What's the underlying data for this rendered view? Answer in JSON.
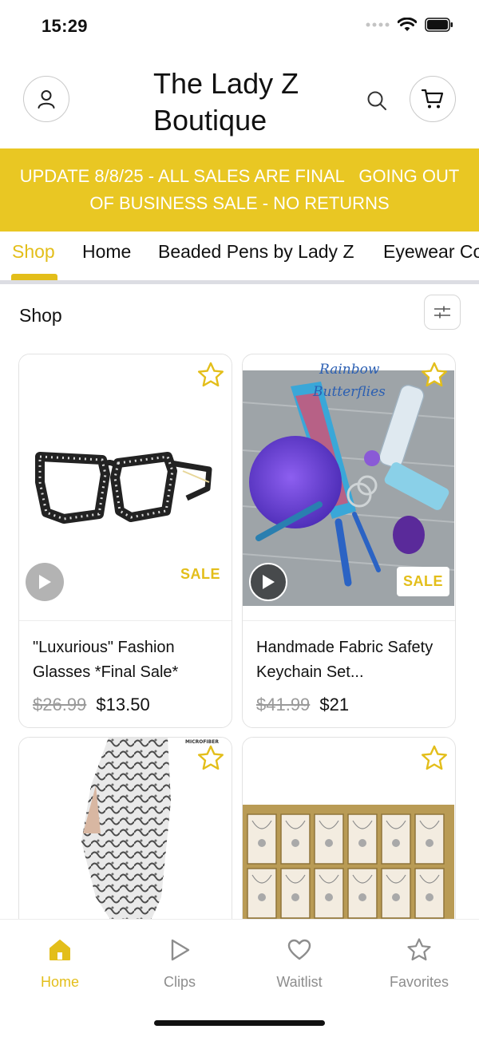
{
  "status": {
    "time": "15:29"
  },
  "header": {
    "title_line1": "The Lady Z",
    "title_line2": "Boutique"
  },
  "banner": {
    "line1": "UPDATE 8/8/25 - ALL SALES ARE FINAL   GOING OUT",
    "line2": "OF BUSINESS SALE - NO RETURNS"
  },
  "tabs": [
    {
      "label": "Shop",
      "active": true
    },
    {
      "label": "Home",
      "active": false
    },
    {
      "label": "Beaded Pens by Lady Z",
      "active": false
    },
    {
      "label": "Eyewear Co",
      "active": false
    }
  ],
  "section": {
    "title": "Shop"
  },
  "products": [
    {
      "name": "\"Luxurious\" Fashion Glasses *Final Sale*",
      "old_price": "$26.99",
      "price": "$13.50",
      "badge": "SALE"
    },
    {
      "name": "Handmade Fabric Safety Keychain Set...",
      "old_price": "$41.99",
      "price": "$21",
      "badge": "SALE",
      "image_text_1": "Rainbow",
      "image_text_2": "Butterflies"
    },
    {
      "name": "",
      "image_text": "MICROFIBER"
    },
    {
      "name": ""
    }
  ],
  "bottom_nav": [
    {
      "label": "Home",
      "icon": "home-icon",
      "active": true
    },
    {
      "label": "Clips",
      "icon": "play-icon",
      "active": false
    },
    {
      "label": "Waitlist",
      "icon": "heart-icon",
      "active": false
    },
    {
      "label": "Favorites",
      "icon": "star-icon",
      "active": false
    }
  ],
  "colors": {
    "accent": "#e3be1a",
    "banner": "#e9c723",
    "muted": "#8d8d8d"
  }
}
